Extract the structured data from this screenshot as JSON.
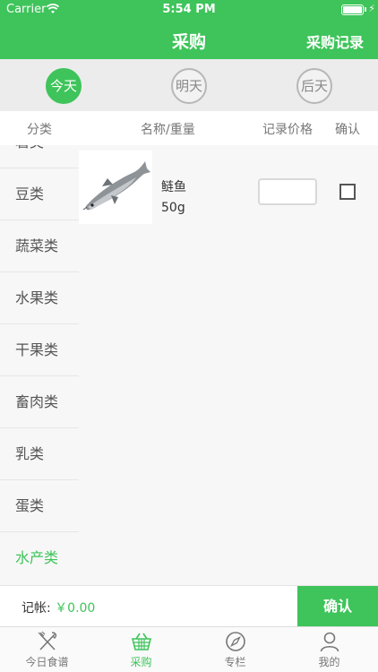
{
  "status": {
    "carrier": "Carrier",
    "time": "5:54 PM"
  },
  "nav": {
    "title": "采购",
    "right_action": "采购记录"
  },
  "days": [
    {
      "label": "今天",
      "active": true
    },
    {
      "label": "明天",
      "active": false
    },
    {
      "label": "后天",
      "active": false
    }
  ],
  "columns": {
    "category": "分类",
    "name_weight": "名称/重量",
    "price": "记录价格",
    "confirm": "确认"
  },
  "categories": [
    {
      "label": "薯类",
      "active": false
    },
    {
      "label": "豆类",
      "active": false
    },
    {
      "label": "蔬菜类",
      "active": false
    },
    {
      "label": "水果类",
      "active": false
    },
    {
      "label": "干果类",
      "active": false
    },
    {
      "label": "畜肉类",
      "active": false
    },
    {
      "label": "乳类",
      "active": false
    },
    {
      "label": "蛋类",
      "active": false
    },
    {
      "label": "水产类",
      "active": true
    }
  ],
  "items": [
    {
      "name": "鲢鱼",
      "weight": "50g",
      "price": "",
      "checked": false,
      "image": "fish-image"
    }
  ],
  "footer": {
    "total_label": "记帐:",
    "total_value": "￥0.00",
    "confirm_label": "确认"
  },
  "tabs": [
    {
      "label": "今日食谱",
      "icon": "utensils-icon",
      "active": false
    },
    {
      "label": "采购",
      "icon": "basket-icon",
      "active": true
    },
    {
      "label": "专栏",
      "icon": "compass-icon",
      "active": false
    },
    {
      "label": "我的",
      "icon": "person-icon",
      "active": false
    }
  ],
  "colors": {
    "accent": "#3ec45a",
    "inactive": "#777777"
  }
}
